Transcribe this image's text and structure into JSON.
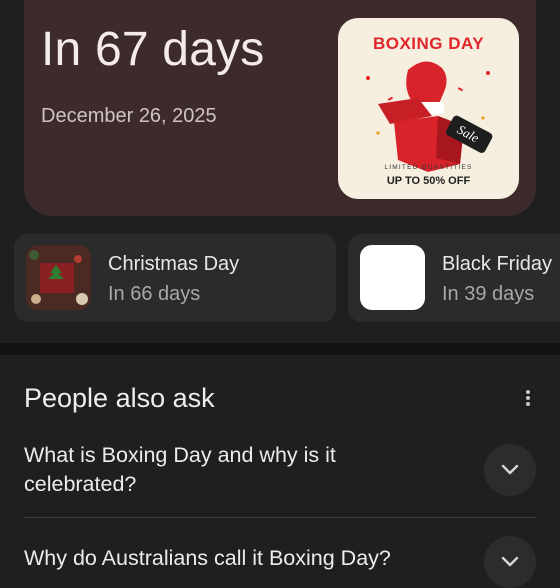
{
  "hero": {
    "title": "In 67 days",
    "date": "December 26, 2025",
    "poster": {
      "headline": "BOXING DAY",
      "tag": "Sale",
      "subline": "LIMITED QUANTITIES",
      "offer": "UP TO 50% OFF"
    }
  },
  "events": [
    {
      "name": "Christmas Day",
      "when": "In 66 days"
    },
    {
      "name": "Black Friday",
      "when": "In 39 days"
    }
  ],
  "people_also_ask": {
    "title": "People also ask",
    "questions": [
      "What is Boxing Day and why is it celebrated?",
      "Why do Australians call it Boxing Day?"
    ]
  },
  "colors": {
    "background": "#1f1f1f",
    "hero_card": "#3d2a2a",
    "card": "#2b2b2b",
    "poster_red": "#e0262a"
  },
  "icons": [
    "more-vert-icon",
    "chevron-down-icon"
  ]
}
